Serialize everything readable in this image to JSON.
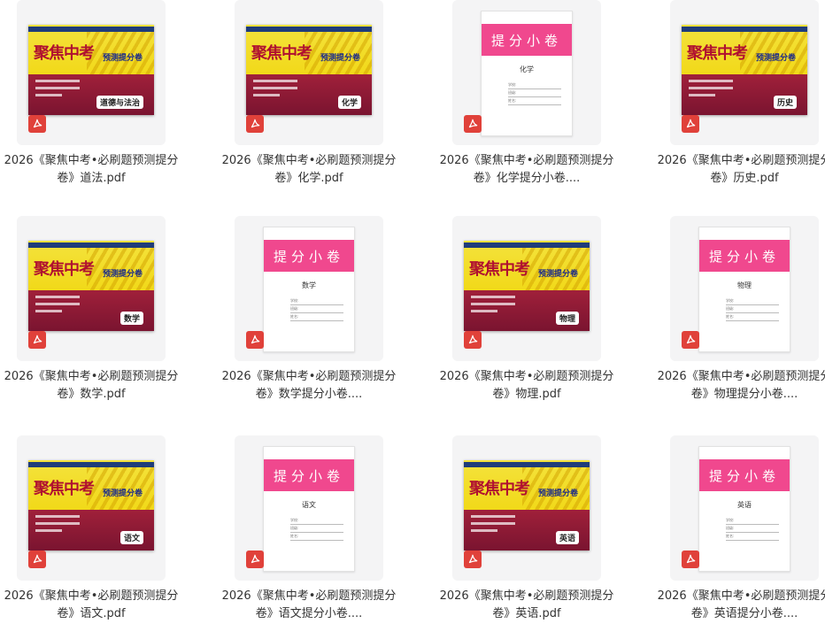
{
  "files": [
    {
      "name": "2026《聚焦中考•必刷题预测提分卷》道法.pdf",
      "cover": "book",
      "subject": "道德与法治"
    },
    {
      "name": "2026《聚焦中考•必刷题预测提分卷》化学.pdf",
      "cover": "book",
      "subject": "化学"
    },
    {
      "name": "2026《聚焦中考•必刷题预测提分卷》化学提分小卷....",
      "cover": "paper",
      "subject": "化学"
    },
    {
      "name": "2026《聚焦中考•必刷题预测提分卷》历史.pdf",
      "cover": "book",
      "subject": "历史"
    },
    {
      "name": "2026《聚焦中考•必刷题预测提分卷》数学.pdf",
      "cover": "book",
      "subject": "数学"
    },
    {
      "name": "2026《聚焦中考•必刷题预测提分卷》数学提分小卷....",
      "cover": "paper",
      "subject": "数学"
    },
    {
      "name": "2026《聚焦中考•必刷题预测提分卷》物理.pdf",
      "cover": "book",
      "subject": "物理"
    },
    {
      "name": "2026《聚焦中考•必刷题预测提分卷》物理提分小卷....",
      "cover": "paper",
      "subject": "物理"
    },
    {
      "name": "2026《聚焦中考•必刷题预测提分卷》语文.pdf",
      "cover": "book",
      "subject": "语文"
    },
    {
      "name": "2026《聚焦中考•必刷题预测提分卷》语文提分小卷....",
      "cover": "paper",
      "subject": "语文"
    },
    {
      "name": "2026《聚焦中考•必刷题预测提分卷》英语.pdf",
      "cover": "book",
      "subject": "英语"
    },
    {
      "name": "2026《聚焦中考•必刷题预测提分卷》英语提分小卷....",
      "cover": "paper",
      "subject": "英语"
    }
  ],
  "cover_text": {
    "book_title": "聚焦中考",
    "book_sub": "预测提分卷",
    "paper_title": "提分小卷",
    "paper_fields": [
      "学校:",
      "班级:",
      "姓名:"
    ]
  },
  "icons": {
    "file_type": "pdf-icon"
  },
  "colors": {
    "pdf_red": "#e0413a",
    "paper_pink": "#f0488e",
    "book_yellow": "#f1d919",
    "book_red": "#a0203a"
  }
}
